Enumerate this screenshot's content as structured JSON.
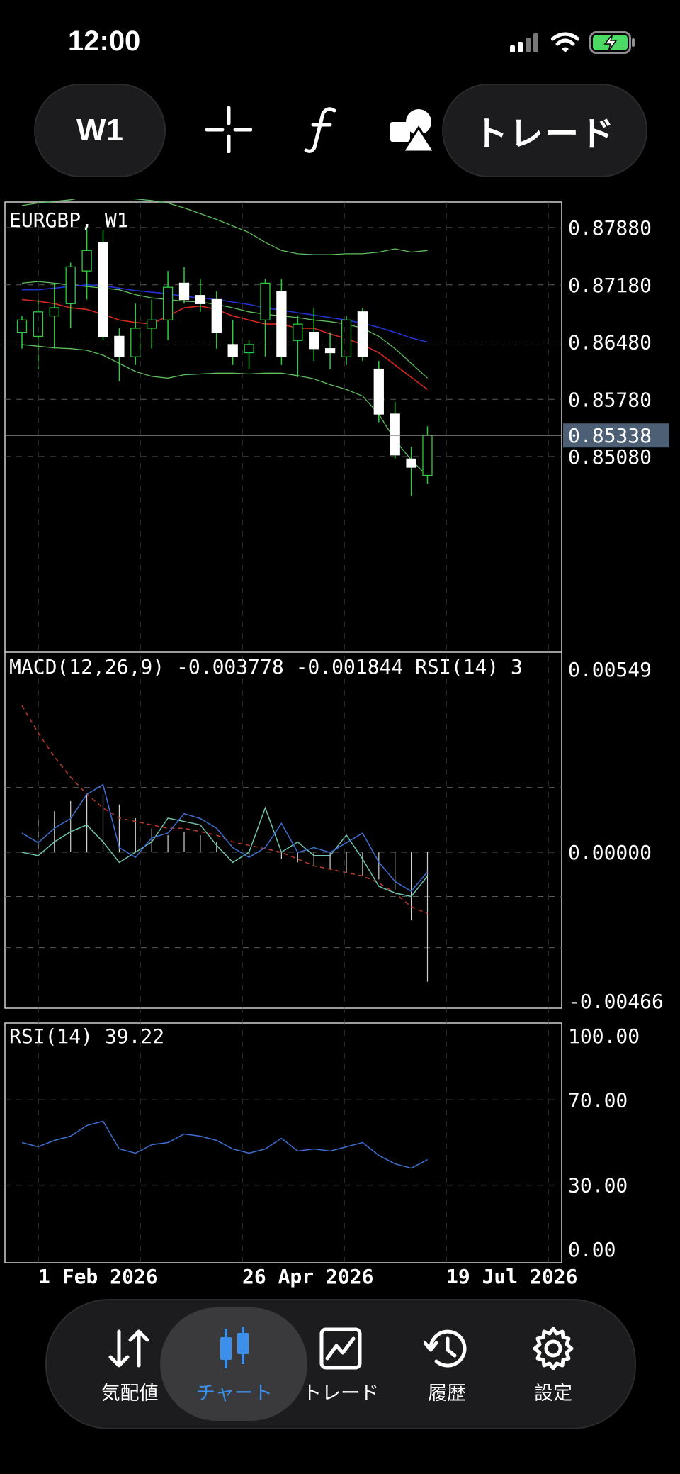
{
  "status_bar": {
    "time": "12:00"
  },
  "toolbar": {
    "timeframe": "W1",
    "trade_label": "トレード",
    "icons": [
      "crosshair-icon",
      "function-icon",
      "shapes-icon"
    ]
  },
  "price_chart": {
    "title": "EURGBP, W1",
    "current_price": "0.85338",
    "price_ticks": [
      "0.87880",
      "0.87180",
      "0.86480",
      "0.85780",
      "0.85080"
    ]
  },
  "macd_panel": {
    "label": "MACD(12,26,9) -0.003778 -0.001844 RSI(14) 3",
    "ticks": [
      "0.00549",
      "0.00000",
      "-0.00466"
    ]
  },
  "rsi_panel": {
    "label": "RSI(14) 39.22",
    "ticks": [
      "100.00",
      "70.00",
      "30.00",
      "0.00"
    ]
  },
  "date_labels": [
    "1 Feb 2026",
    "26 Apr 2026",
    "19 Jul 2026"
  ],
  "tabs": [
    {
      "label": "気配値",
      "icon": "arrows-updown-icon"
    },
    {
      "label": "チャート",
      "icon": "candlestick-icon"
    },
    {
      "label": "トレード",
      "icon": "trade-chart-icon"
    },
    {
      "label": "履歴",
      "icon": "history-icon"
    },
    {
      "label": "設定",
      "icon": "gear-icon"
    }
  ],
  "active_tab": "チャート",
  "colors": {
    "bull_candle": "#ffffff",
    "wick": "#2ecc40",
    "bollinger": "#5fbf5f",
    "ma_fast": "#d42a1e",
    "ma_slow": "#2233cc",
    "macd_line": "#6fc2b0",
    "signal": "#c0392b",
    "rsi": "#3d6fd1",
    "accent": "#3c8fea"
  },
  "chart_data": {
    "type": "candlestick",
    "symbol": "EURGBP",
    "timeframe": "W1",
    "ylim": [
      0.845,
      0.88
    ],
    "candles": [
      {
        "o": 0.866,
        "h": 0.868,
        "l": 0.864,
        "c": 0.8675
      },
      {
        "o": 0.8655,
        "h": 0.87,
        "l": 0.8615,
        "c": 0.8685
      },
      {
        "o": 0.868,
        "h": 0.872,
        "l": 0.864,
        "c": 0.869
      },
      {
        "o": 0.8695,
        "h": 0.8745,
        "l": 0.8665,
        "c": 0.874
      },
      {
        "o": 0.8735,
        "h": 0.879,
        "l": 0.87,
        "c": 0.876
      },
      {
        "o": 0.877,
        "h": 0.8785,
        "l": 0.865,
        "c": 0.8655
      },
      {
        "o": 0.8655,
        "h": 0.8665,
        "l": 0.86,
        "c": 0.863
      },
      {
        "o": 0.863,
        "h": 0.8695,
        "l": 0.862,
        "c": 0.8665
      },
      {
        "o": 0.8665,
        "h": 0.87,
        "l": 0.864,
        "c": 0.8675
      },
      {
        "o": 0.8675,
        "h": 0.8735,
        "l": 0.865,
        "c": 0.8715
      },
      {
        "o": 0.872,
        "h": 0.874,
        "l": 0.8695,
        "c": 0.87
      },
      {
        "o": 0.8705,
        "h": 0.8725,
        "l": 0.8685,
        "c": 0.8695
      },
      {
        "o": 0.87,
        "h": 0.871,
        "l": 0.864,
        "c": 0.866
      },
      {
        "o": 0.8645,
        "h": 0.8675,
        "l": 0.862,
        "c": 0.863
      },
      {
        "o": 0.8635,
        "h": 0.865,
        "l": 0.8615,
        "c": 0.8645
      },
      {
        "o": 0.8675,
        "h": 0.8725,
        "l": 0.863,
        "c": 0.872
      },
      {
        "o": 0.871,
        "h": 0.8725,
        "l": 0.862,
        "c": 0.863
      },
      {
        "o": 0.865,
        "h": 0.868,
        "l": 0.8605,
        "c": 0.867
      },
      {
        "o": 0.866,
        "h": 0.869,
        "l": 0.8625,
        "c": 0.864
      },
      {
        "o": 0.864,
        "h": 0.866,
        "l": 0.8615,
        "c": 0.8635
      },
      {
        "o": 0.863,
        "h": 0.868,
        "l": 0.862,
        "c": 0.8675
      },
      {
        "o": 0.8685,
        "h": 0.869,
        "l": 0.8625,
        "c": 0.863
      },
      {
        "o": 0.8615,
        "h": 0.8625,
        "l": 0.855,
        "c": 0.856
      },
      {
        "o": 0.856,
        "h": 0.8575,
        "l": 0.8505,
        "c": 0.851
      },
      {
        "o": 0.8505,
        "h": 0.852,
        "l": 0.846,
        "c": 0.8495
      },
      {
        "o": 0.8485,
        "h": 0.8545,
        "l": 0.8475,
        "c": 0.8534
      }
    ],
    "ma_fast": [
      0.87,
      0.8698,
      0.8695,
      0.869,
      0.8688,
      0.8682,
      0.8675,
      0.8672,
      0.867,
      0.868,
      0.869,
      0.8692,
      0.8688,
      0.868,
      0.8675,
      0.867,
      0.867,
      0.8665,
      0.8665,
      0.8658,
      0.8652,
      0.8645,
      0.8635,
      0.862,
      0.8605,
      0.859
    ],
    "ma_slow": [
      0.8712,
      0.8712,
      0.8714,
      0.8716,
      0.8718,
      0.8717,
      0.8714,
      0.8711,
      0.8709,
      0.8707,
      0.8704,
      0.8702,
      0.87,
      0.8697,
      0.8694,
      0.869,
      0.8687,
      0.8684,
      0.8681,
      0.8678,
      0.8675,
      0.8671,
      0.8666,
      0.866,
      0.8653,
      0.8648
    ],
    "bb_upper": [
      0.8815,
      0.8818,
      0.882,
      0.8822,
      0.8826,
      0.8828,
      0.8826,
      0.8823,
      0.8821,
      0.8818,
      0.8812,
      0.8805,
      0.8798,
      0.879,
      0.8782,
      0.877,
      0.876,
      0.8756,
      0.8755,
      0.8755,
      0.8756,
      0.8756,
      0.8758,
      0.8762,
      0.8758,
      0.876
    ],
    "bb_middle": [
      0.872,
      0.8722,
      0.872,
      0.8718,
      0.8716,
      0.8714,
      0.8712,
      0.8706,
      0.8702,
      0.87,
      0.8698,
      0.8697,
      0.8694,
      0.869,
      0.8685,
      0.8682,
      0.868,
      0.8678,
      0.8675,
      0.8673,
      0.867,
      0.8665,
      0.8655,
      0.864,
      0.8622,
      0.8604
    ],
    "bb_lower": [
      0.8645,
      0.8643,
      0.8641,
      0.864,
      0.8638,
      0.8632,
      0.8622,
      0.8612,
      0.8606,
      0.8604,
      0.8608,
      0.8609,
      0.861,
      0.861,
      0.8609,
      0.861,
      0.861,
      0.8607,
      0.8603,
      0.8596,
      0.859,
      0.8582,
      0.856,
      0.8528,
      0.8504,
      0.8484
    ],
    "macd_ylim": [
      -0.00466,
      0.00549
    ],
    "macd_hist": [
      0.0,
      0.001,
      0.0012,
      0.0015,
      0.0017,
      0.0017,
      0.0014,
      0.001,
      0.0007,
      0.0005,
      0.0006,
      0.0005,
      0.0003,
      0.0,
      -0.0001,
      0.0,
      -0.0002,
      -0.0003,
      -0.0004,
      -0.0005,
      -0.0006,
      -0.0007,
      -0.0008,
      -0.0011,
      -0.002,
      -0.0038
    ],
    "macd_line": [
      0.0,
      -0.0001,
      0.0003,
      0.0006,
      0.0008,
      0.0003,
      -0.0003,
      0.0,
      0.0003,
      0.001,
      0.0009,
      0.0008,
      0.0002,
      -0.0003,
      0.0,
      0.0013,
      0.0,
      0.0003,
      -0.0001,
      -0.0001,
      0.0005,
      -0.0002,
      -0.001,
      -0.0012,
      -0.0013,
      -0.0007
    ],
    "macd_signal": [
      0.0043,
      0.0035,
      0.0028,
      0.0022,
      0.0017,
      0.0013,
      0.001,
      0.0009,
      0.0008,
      0.0007,
      0.0007,
      0.0006,
      0.0005,
      0.0003,
      0.0002,
      0.0001,
      0.0,
      -0.0002,
      -0.0004,
      -0.0005,
      -0.0006,
      -0.0007,
      -0.0009,
      -0.0012,
      -0.0016,
      -0.0018
    ],
    "rsi_ylim": [
      0,
      100
    ],
    "rsi": [
      50,
      48,
      51,
      53,
      58,
      60,
      47,
      45,
      49,
      50,
      54,
      53,
      51,
      47,
      45,
      47,
      52,
      46,
      47,
      46,
      48,
      50,
      44,
      40,
      38,
      42
    ]
  }
}
